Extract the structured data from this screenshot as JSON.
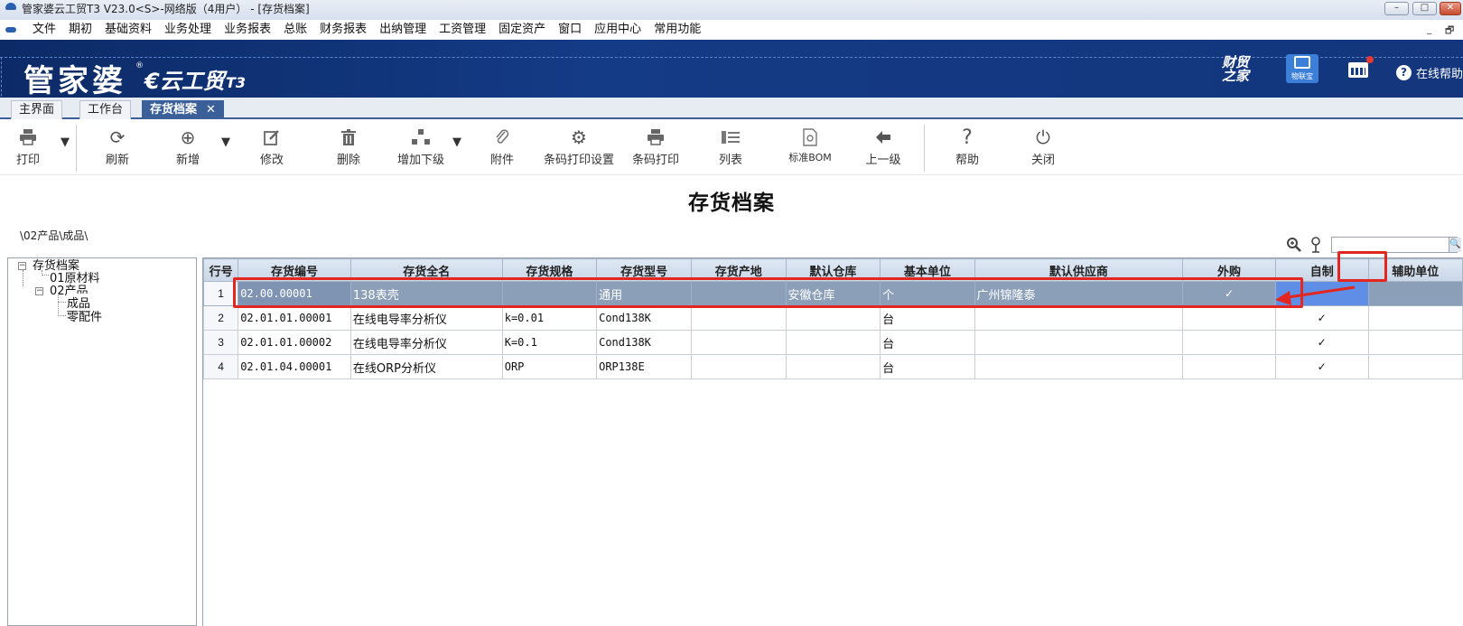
{
  "window": {
    "title": "管家婆云工贸T3 V23.0<S>-网络版（4用户） - [存货档案]",
    "min_label": "–",
    "max_label": "□",
    "close_label": "✕"
  },
  "menu": {
    "items": [
      "文件",
      "期初",
      "基础资料",
      "业务处理",
      "业务报表",
      "总账",
      "财务报表",
      "出纳管理",
      "工资管理",
      "固定资产",
      "窗口",
      "应用中心",
      "常用功能"
    ],
    "mdi_min": "_",
    "mdi_restore": "🗗"
  },
  "banner": {
    "brand": "管家婆",
    "reg": "®",
    "product": "€云工贸",
    "product_suffix": "T3",
    "zhijia": "财贸之家",
    "wulianbao": "物联宝",
    "help_online": "在线帮助"
  },
  "tabs": [
    {
      "label": "主界面"
    },
    {
      "label": "工作台"
    },
    {
      "label": "存货档案",
      "close": "✕"
    }
  ],
  "toolbar": {
    "print": "打印",
    "refresh": "刷新",
    "add": "新增",
    "edit": "修改",
    "delete": "删除",
    "add_sub": "增加下级",
    "attach": "附件",
    "barcode_setup": "条码打印设置",
    "barcode_print": "条码打印",
    "list": "列表",
    "bom": "标准BOM",
    "up": "上一级",
    "help": "帮助",
    "close": "关闭"
  },
  "page": {
    "title": "存货档案",
    "path": "\\02产品\\成品\\"
  },
  "tree": {
    "root": "存货档案",
    "n01": "01原材料",
    "n02": "02产品",
    "finished": "成品",
    "parts": "零配件"
  },
  "grid": {
    "headers": [
      "行号",
      "存货编号",
      "存货全名",
      "存货规格",
      "存货型号",
      "存货产地",
      "默认仓库",
      "基本单位",
      "默认供应商",
      "外购",
      "自制",
      "辅助单位"
    ],
    "rows": [
      {
        "no": "1",
        "code": "02.00.00001",
        "name": "138表壳",
        "spec": "",
        "model": "通用",
        "origin": "",
        "warehouse": "安徽仓库",
        "unit": "个",
        "supplier": "广州锦隆泰",
        "purchased": "✓",
        "selfmade": "",
        "aux": ""
      },
      {
        "no": "2",
        "code": "02.01.01.00001",
        "name": "在线电导率分析仪",
        "spec": "k=0.01",
        "model": "Cond138K",
        "origin": "",
        "warehouse": "",
        "unit": "台",
        "supplier": "",
        "purchased": "",
        "selfmade": "✓",
        "aux": ""
      },
      {
        "no": "3",
        "code": "02.01.01.00002",
        "name": "在线电导率分析仪",
        "spec": "K=0.1",
        "model": "Cond138K",
        "origin": "",
        "warehouse": "",
        "unit": "台",
        "supplier": "",
        "purchased": "",
        "selfmade": "✓",
        "aux": ""
      },
      {
        "no": "4",
        "code": "02.01.04.00001",
        "name": "在线ORP分析仪",
        "spec": "ORP",
        "model": "ORP138E",
        "origin": "",
        "warehouse": "",
        "unit": "台",
        "supplier": "",
        "purchased": "",
        "selfmade": "✓",
        "aux": ""
      }
    ]
  },
  "search": {
    "placeholder": ""
  },
  "colors": {
    "banner": "#143b86",
    "tab_active": "#3b5f98",
    "annotation": "#e3261f",
    "selected_row": "#8c9fb8"
  }
}
